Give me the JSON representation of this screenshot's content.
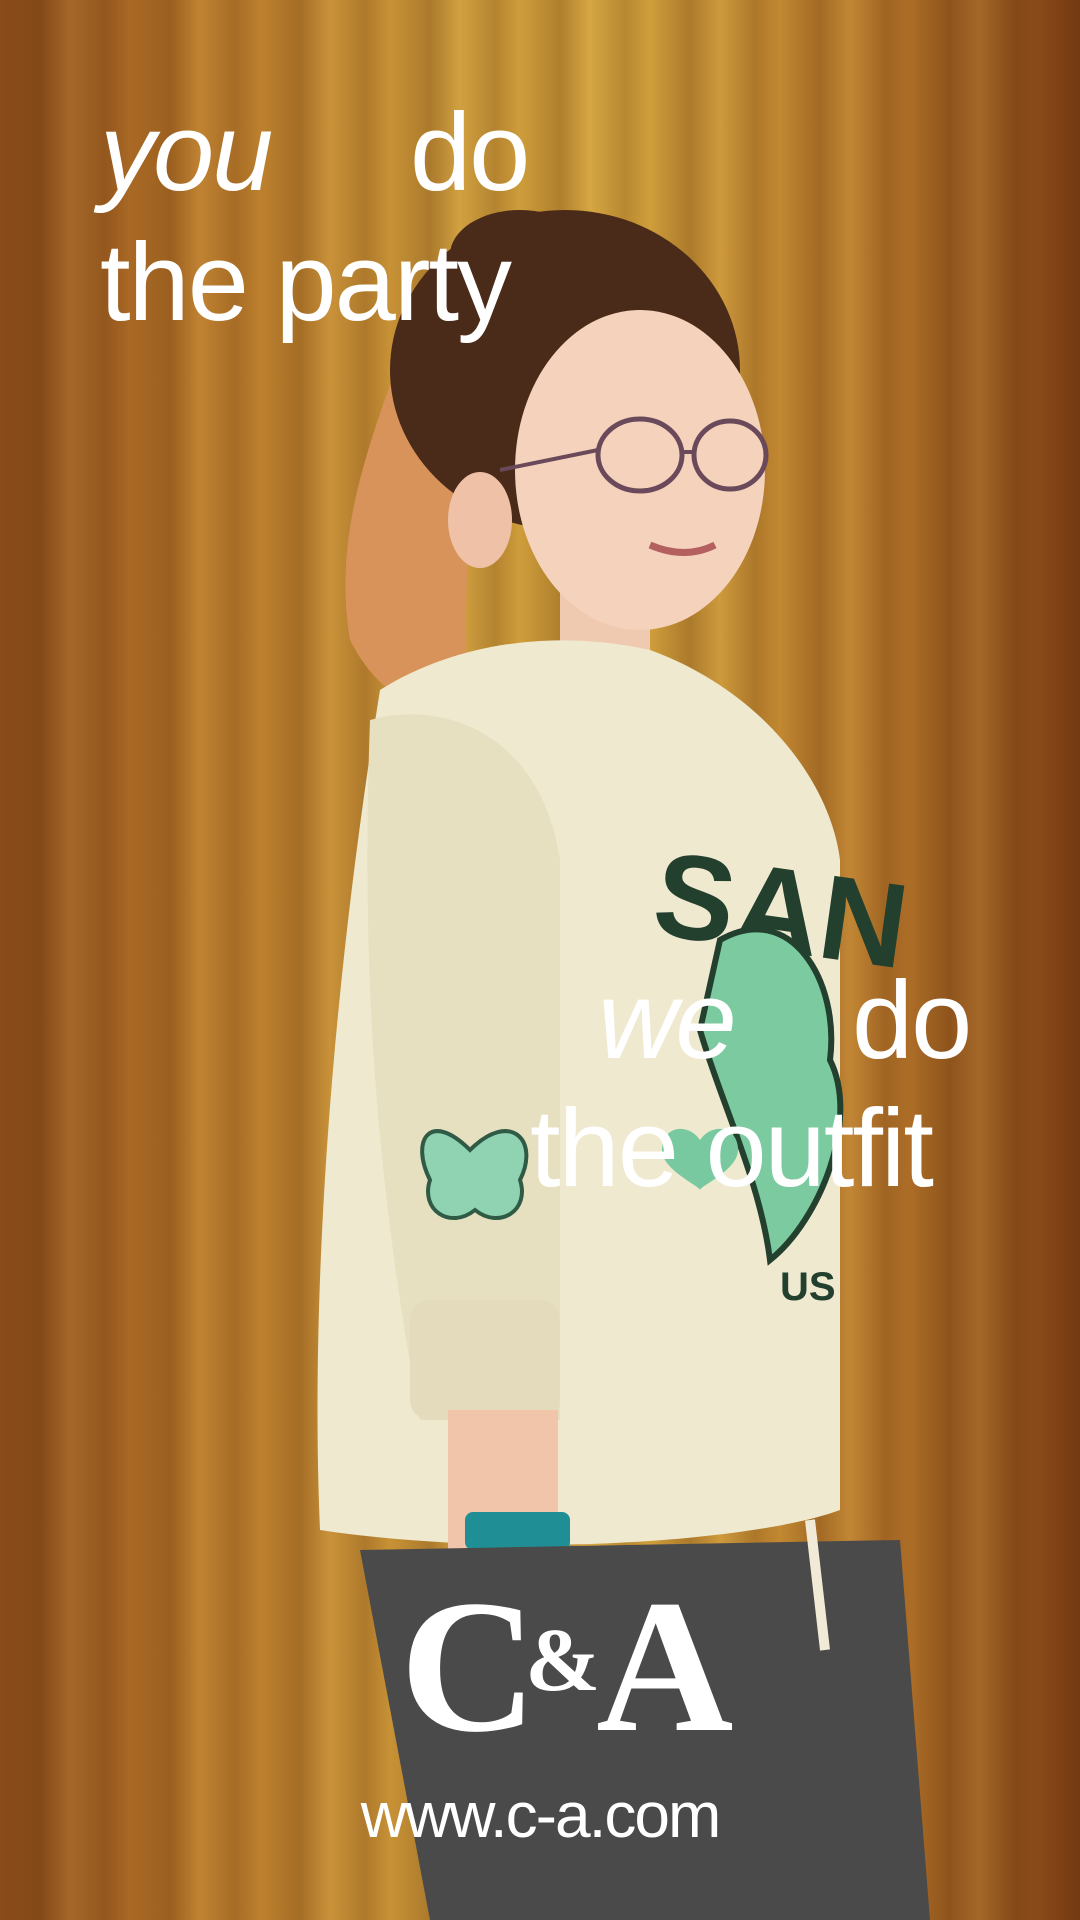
{
  "headline_top": {
    "word_you": "you",
    "word_do": "do",
    "line_party": "the party"
  },
  "headline_bottom": {
    "word_we": "we",
    "word_do": "do",
    "line_outfit": "the outfit"
  },
  "brand": {
    "logo_c": "C",
    "logo_amp": "&",
    "logo_a": "A",
    "url": "www.c-a.com"
  },
  "colors": {
    "curtain": "#c38a34",
    "text": "#ffffff",
    "sweater": "#efe9cf",
    "accent_green": "#79c9a0"
  }
}
